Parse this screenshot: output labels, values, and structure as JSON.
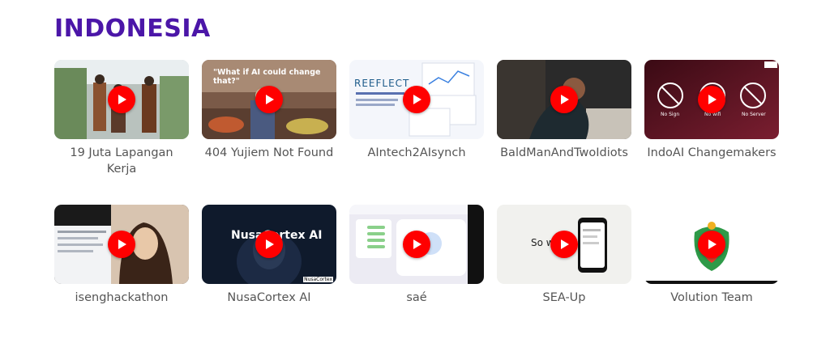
{
  "section": {
    "title": "INDONESIA"
  },
  "videos": [
    {
      "label": "19 Juta Lapangan Kerja"
    },
    {
      "label": "404 Yujiem Not Found",
      "thumb_text": "\"What if AI could change that?\""
    },
    {
      "label": "AIntech2AIsynch",
      "thumb_text": "REEFLECT"
    },
    {
      "label": "BaldManAndTwoIdiots"
    },
    {
      "label": "IndoAI Changemakers",
      "thumb_captions": [
        "No Sign",
        "No wifi",
        "No Server"
      ]
    },
    {
      "label": "isenghackathon"
    },
    {
      "label": "NusaCortex AI",
      "thumb_text": "NusaCortex AI",
      "thumb_corner": "NusaCortex"
    },
    {
      "label": "saé"
    },
    {
      "label": "SEA-Up",
      "thumb_text": "So w"
    },
    {
      "label": "Volution Team"
    }
  ],
  "colors": {
    "title": "#4b16a8",
    "play": "#ff0000",
    "label": "#555555"
  }
}
